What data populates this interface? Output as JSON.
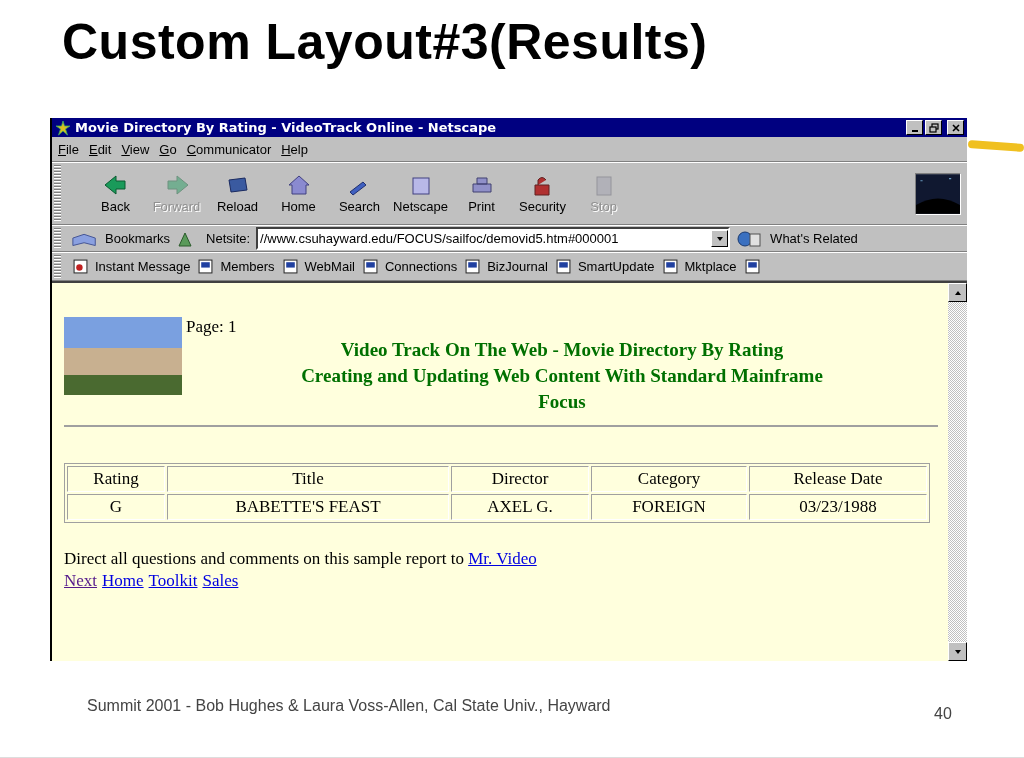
{
  "slide_title": "Custom Layout#3(Results)",
  "window": {
    "title": "Movie Directory By Rating - VideoTrack Online - Netscape"
  },
  "menu": [
    "File",
    "Edit",
    "View",
    "Go",
    "Communicator",
    "Help"
  ],
  "toolbar": [
    {
      "label": "Back",
      "disabled": false
    },
    {
      "label": "Forward",
      "disabled": true
    },
    {
      "label": "Reload",
      "disabled": false
    },
    {
      "label": "Home",
      "disabled": false
    },
    {
      "label": "Search",
      "disabled": false
    },
    {
      "label": "Netscape",
      "disabled": false
    },
    {
      "label": "Print",
      "disabled": false
    },
    {
      "label": "Security",
      "disabled": false
    },
    {
      "label": "Stop",
      "disabled": true
    }
  ],
  "location_bar": {
    "bookmarks": "Bookmarks",
    "field_label": "Netsite:",
    "url": "//www.csuhayward.edu/FOCUS/sailfoc/demovid5.htm#000001",
    "related": "What's Related"
  },
  "personal_toolbar": [
    "Instant Message",
    "Members",
    "WebMail",
    "Connections",
    "BizJournal",
    "SmartUpdate",
    "Mktplace"
  ],
  "page": {
    "page_label": "Page: 1",
    "heading_lines": [
      "Video Track On The Web - Movie Directory By Rating",
      "Creating and Updating Web Content With Standard Mainframe",
      "Focus"
    ],
    "table": {
      "columns": [
        "Rating",
        "Title",
        "Director",
        "Category",
        "Release Date"
      ],
      "rows": [
        [
          "G",
          "BABETTE'S FEAST",
          "AXEL G.",
          "FOREIGN",
          "03/23/1988"
        ]
      ]
    },
    "note": {
      "text": "Direct all questions and comments on this sample report to",
      "link": "Mr. Video"
    },
    "links": [
      {
        "label": "Next",
        "visited": true
      },
      {
        "label": "Home",
        "visited": false
      },
      {
        "label": "Toolkit",
        "visited": false
      },
      {
        "label": "Sales",
        "visited": false
      }
    ]
  },
  "footer": {
    "credit": "Summit 2001 - Bob Hughes & Laura Voss-Allen, Cal State Univ., Hayward",
    "page_number": "40"
  }
}
